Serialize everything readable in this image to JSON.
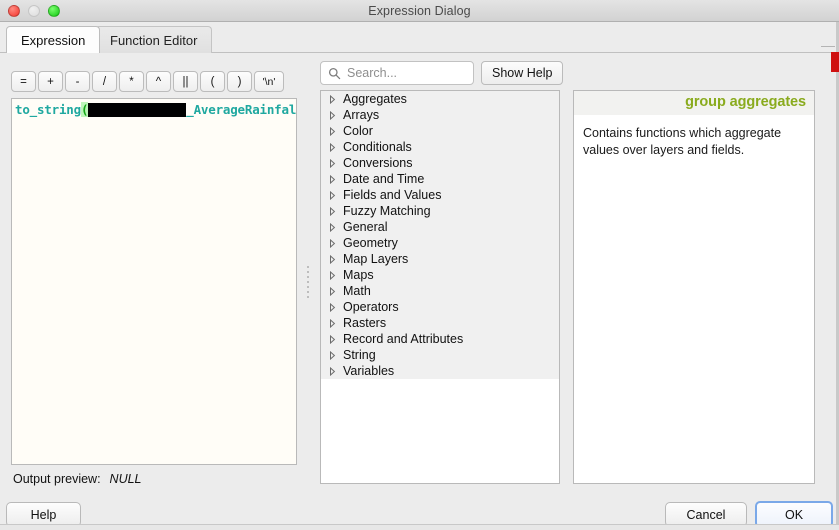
{
  "window": {
    "title": "Expression Dialog",
    "traffic_lights": [
      "close",
      "minimize",
      "zoom"
    ]
  },
  "tabs": [
    {
      "label": "Expression",
      "active": true
    },
    {
      "label": "Function Editor",
      "active": false
    }
  ],
  "operators": [
    {
      "label": "=",
      "name": "equals"
    },
    {
      "label": "+",
      "name": "plus"
    },
    {
      "label": "-",
      "name": "minus"
    },
    {
      "label": "/",
      "name": "divide"
    },
    {
      "label": "*",
      "name": "multiply"
    },
    {
      "label": "^",
      "name": "power"
    },
    {
      "label": "||",
      "name": "concat"
    },
    {
      "label": "(",
      "name": "open-paren"
    },
    {
      "label": ")",
      "name": "close-paren"
    },
    {
      "label": "'\\n'",
      "name": "newline"
    }
  ],
  "expression": {
    "function_name": "to_string",
    "open_paren": "(",
    "redacted": "",
    "field_name": "_AverageRainfall",
    "close_paren": ")",
    "full_text": "to_string(████████_AverageRainfall)"
  },
  "search": {
    "placeholder": "Search...",
    "value": "",
    "icon": "search-icon"
  },
  "show_help": {
    "label": "Show Help"
  },
  "function_tree": {
    "items": [
      {
        "label": "Aggregates"
      },
      {
        "label": "Arrays"
      },
      {
        "label": "Color"
      },
      {
        "label": "Conditionals"
      },
      {
        "label": "Conversions"
      },
      {
        "label": "Date and Time"
      },
      {
        "label": "Fields and Values"
      },
      {
        "label": "Fuzzy Matching"
      },
      {
        "label": "General"
      },
      {
        "label": "Geometry"
      },
      {
        "label": "Map Layers"
      },
      {
        "label": "Maps"
      },
      {
        "label": "Math"
      },
      {
        "label": "Operators"
      },
      {
        "label": "Rasters"
      },
      {
        "label": "Record and Attributes"
      },
      {
        "label": "String"
      },
      {
        "label": "Variables"
      }
    ]
  },
  "help": {
    "title": "group aggregates",
    "body": "Contains functions which aggregate values over layers and fields.",
    "title_color": "#8aab1e"
  },
  "output_preview": {
    "label": "Output preview:",
    "value": "NULL"
  },
  "buttons": {
    "help": "Help",
    "cancel": "Cancel",
    "ok": "OK"
  }
}
